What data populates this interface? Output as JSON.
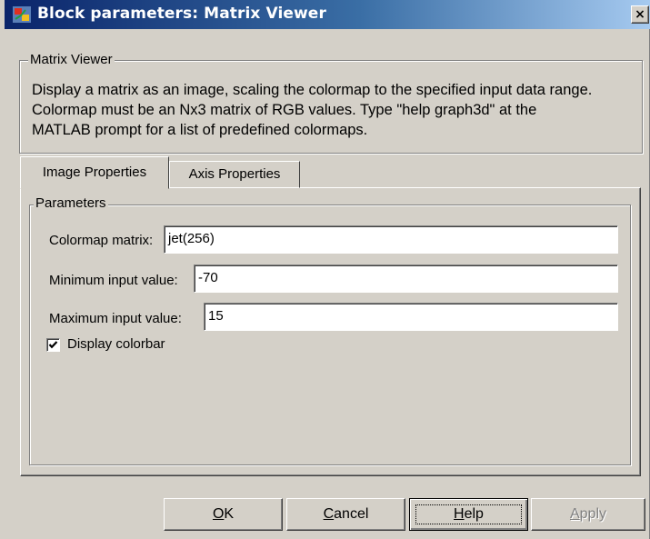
{
  "window": {
    "title": "Block parameters: Matrix Viewer",
    "close_glyph": "×"
  },
  "description_group": {
    "legend": "Matrix Viewer",
    "lines": [
      "Display a matrix as an image, scaling the colormap to the specified input data range.",
      "Colormap must be an Nx3 matrix of RGB values.  Type \"help graph3d\" at the",
      "MATLAB prompt for a list of predefined colormaps."
    ]
  },
  "tabs": [
    {
      "label": "Image Properties",
      "active": true
    },
    {
      "label": "Axis Properties",
      "active": false
    }
  ],
  "parameters": {
    "legend": "Parameters",
    "colormap": {
      "label": "Colormap matrix:",
      "value": "jet(256)"
    },
    "min_input": {
      "label": "Minimum input value:",
      "value": "-70"
    },
    "max_input": {
      "label": "Maximum input value:",
      "value": "15"
    },
    "display_colorbar": {
      "label": "Display colorbar",
      "checked": true
    }
  },
  "buttons": {
    "ok": {
      "mnemonic": "O",
      "rest": "K"
    },
    "cancel": {
      "mnemonic": "C",
      "rest": "ancel"
    },
    "help": {
      "mnemonic": "H",
      "rest": "elp"
    },
    "apply": {
      "mnemonic": "A",
      "rest": "pply",
      "enabled": false
    }
  },
  "icons": {
    "app_icon": "simulink-block-icon",
    "close": "close-icon",
    "checkbox": "checkmark-icon"
  }
}
